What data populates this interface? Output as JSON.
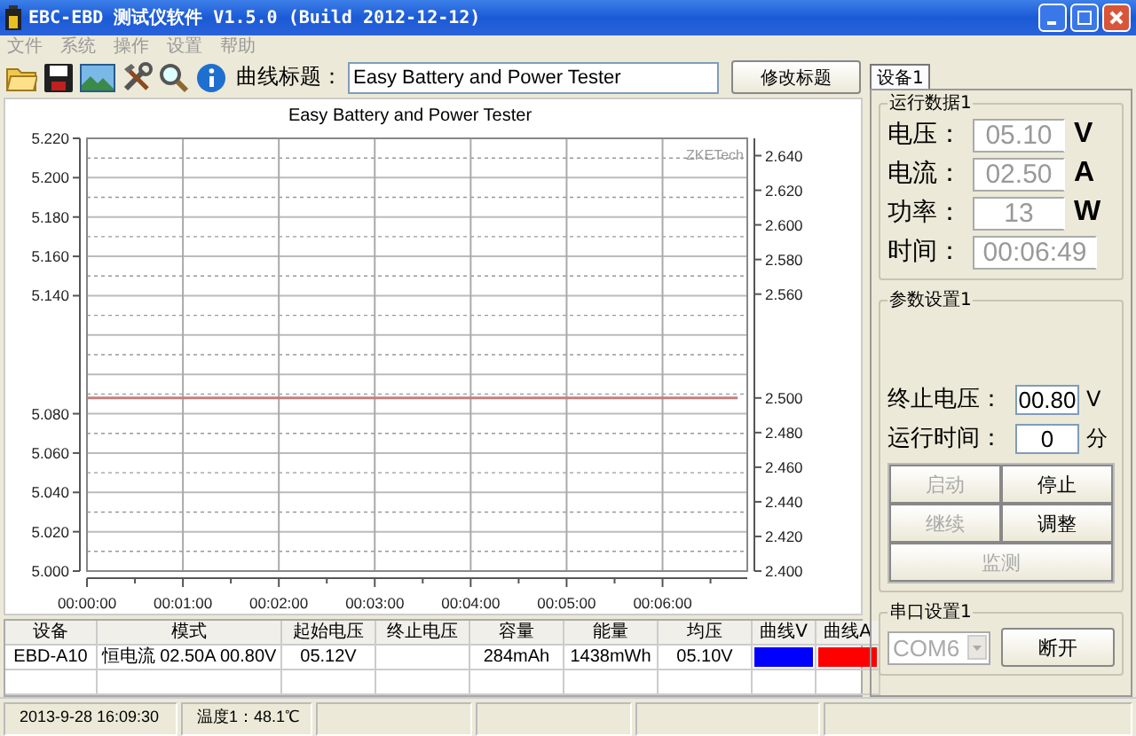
{
  "window": {
    "title": "EBC-EBD 测试仪软件 V1.5.0 (Build 2012-12-12)"
  },
  "menu": [
    {
      "label": "文件"
    },
    {
      "label": "系统"
    },
    {
      "label": "操作"
    },
    {
      "label": "设置"
    },
    {
      "label": "帮助"
    }
  ],
  "toolbar": {
    "title_label": "曲线标题：",
    "title_value": "Easy Battery and Power Tester",
    "rename_button": "修改标题"
  },
  "chart": {
    "chart_data": {
      "type": "line",
      "title": "Easy Battery and Power Tester",
      "x": [
        0,
        407
      ],
      "xlim": [
        0,
        413
      ],
      "xticks": [
        {
          "value": 0,
          "label": "00:00:00"
        },
        {
          "value": 60,
          "label": "00:01:00"
        },
        {
          "value": 120,
          "label": "00:02:00"
        },
        {
          "value": 180,
          "label": "00:03:00"
        },
        {
          "value": 240,
          "label": "00:04:00"
        },
        {
          "value": 300,
          "label": "00:05:00"
        },
        {
          "value": 360,
          "label": "00:06:00"
        }
      ],
      "y2lim": [
        5.0,
        5.22
      ],
      "y2ticks": [
        {
          "value": 5.0,
          "label": "5.000"
        },
        {
          "value": 5.02,
          "label": "5.020"
        },
        {
          "value": 5.04,
          "label": "5.040"
        },
        {
          "value": 5.06,
          "label": "5.060"
        },
        {
          "value": 5.08,
          "label": "5.080"
        },
        {
          "value": 5.14,
          "label": "5.140"
        },
        {
          "value": 5.16,
          "label": "5.160"
        },
        {
          "value": 5.18,
          "label": "5.180"
        },
        {
          "value": 5.2,
          "label": "5.200"
        },
        {
          "value": 5.22,
          "label": "5.220"
        }
      ],
      "ylim": [
        2.4,
        2.65
      ],
      "yticks": [
        {
          "value": 2.4,
          "label": "2.400"
        },
        {
          "value": 2.42,
          "label": "2.420"
        },
        {
          "value": 2.44,
          "label": "2.440"
        },
        {
          "value": 2.46,
          "label": "2.460"
        },
        {
          "value": 2.48,
          "label": "2.480"
        },
        {
          "value": 2.5,
          "label": "2.500"
        },
        {
          "value": 2.56,
          "label": "2.560"
        },
        {
          "value": 2.58,
          "label": "2.580"
        },
        {
          "value": 2.6,
          "label": "2.600"
        },
        {
          "value": 2.62,
          "label": "2.620"
        },
        {
          "value": 2.64,
          "label": "2.640"
        }
      ],
      "series": [
        {
          "color": "#c08080",
          "values": [
            2.5,
            2.5
          ]
        }
      ],
      "annotations": [
        "ZKETech"
      ],
      "grid": true
    }
  },
  "device_tab": {
    "label": "设备1",
    "selected": true
  },
  "run_data": {
    "title": "运行数据1",
    "rows": [
      {
        "label": "电压：",
        "value": "05.10",
        "unit": "V",
        "disabled": true
      },
      {
        "label": "电流：",
        "value": "02.50",
        "unit": "A",
        "disabled": true
      },
      {
        "label": "功率：",
        "value": "13",
        "unit": "W",
        "disabled": true
      },
      {
        "label": "时间：",
        "value": "00:06:49",
        "disabled": true
      }
    ]
  },
  "params": {
    "title": "参数设置1",
    "rows": [
      {
        "label": "终止电压：",
        "value": "00.80",
        "unit": "V"
      },
      {
        "label": "运行时间：",
        "value": "0",
        "unit": "分"
      }
    ],
    "buttons": [
      {
        "label": "启动",
        "disabled": true
      },
      {
        "label": "停止",
        "disabled": false
      },
      {
        "label": "继续",
        "disabled": true
      },
      {
        "label": "调整",
        "disabled": false
      },
      {
        "label": "监测",
        "disabled": true
      }
    ]
  },
  "serial": {
    "title": "串口设置1",
    "port": {
      "value": "COM6",
      "disabled": true
    },
    "button": "断开"
  },
  "table": {
    "columns": [
      "设备",
      "模式",
      "起始电压",
      "终止电压",
      "容量",
      "能量",
      "均压",
      "曲线V",
      "曲线A"
    ],
    "rows": [
      {
        "cells": [
          {
            "text": "EBD-A10"
          },
          {
            "text": "恒电流  02.50A  00.80V"
          },
          {
            "text": "05.12V"
          },
          {},
          {
            "text": "284mAh"
          },
          {
            "text": "1438mWh"
          },
          {
            "text": "05.10V"
          },
          {
            "color": "#0000ff"
          },
          {
            "color": "#ff0000"
          }
        ]
      }
    ]
  },
  "status_bar": [
    "2013-9-28 16:09:30",
    "温度1：48.1℃"
  ]
}
